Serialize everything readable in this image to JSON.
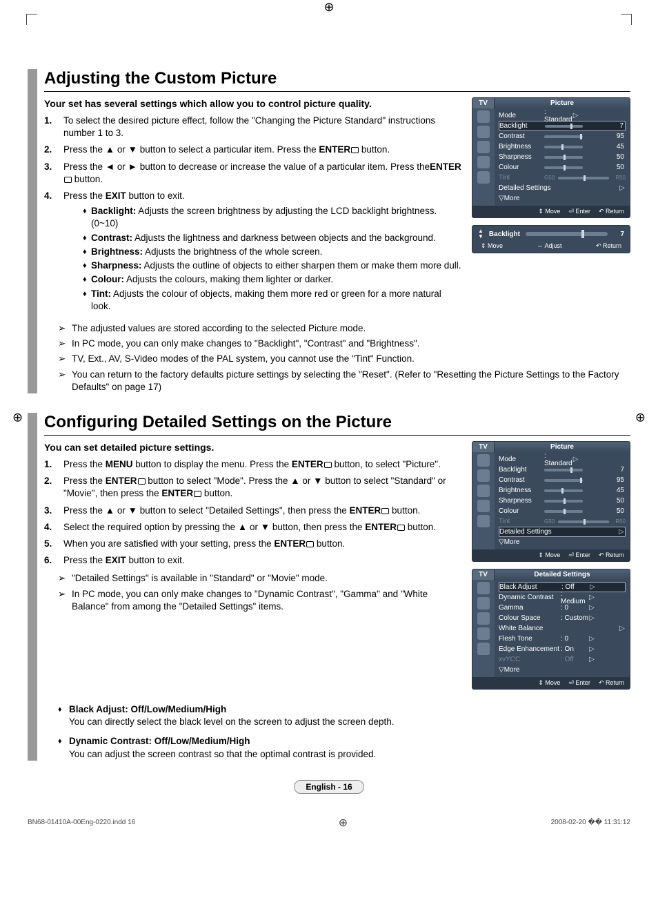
{
  "sections": {
    "s1": {
      "title": "Adjusting the Custom Picture",
      "intro": "Your set has several settings which allow you to control picture quality.",
      "steps": {
        "1a": "To select the desired picture effect, follow the \"Changing the Picture Standard\" instructions number 1 to 3.",
        "2a": "Press the ▲ or ▼ button to select a particular item. Press the ",
        "2b": "ENTER",
        "2c": " button.",
        "3a": "Press the ◄ or ► button to decrease or increase the value of a particular item. Press the",
        "3b": "ENTER",
        "3c": " button.",
        "4a": "Press the ",
        "4b": "EXIT",
        "4c": " button to exit."
      },
      "bullets": {
        "b1l": "Backlight:",
        "b1t": " Adjusts the screen brightness by adjusting the LCD backlight brightness. (0~10)",
        "b2l": "Contrast:",
        "b2t": " Adjusts the lightness and darkness between objects and the background.",
        "b3l": "Brightness:",
        "b3t": " Adjusts the brightness of the whole screen.",
        "b4l": "Sharpness:",
        "b4t": " Adjusts the outline of objects to either sharpen them or make them more dull.",
        "b5l": "Colour:",
        "b5t": " Adjusts the colours, making them lighter or darker.",
        "b6l": "Tint:",
        "b6t": " Adjusts the colour of objects, making them more red or green for a more natural look."
      },
      "notes": {
        "n1": "The adjusted values are stored according to the selected Picture mode.",
        "n2": "In PC mode, you can only make changes to \"Backlight\", \"Contrast\" and  \"Brightness\".",
        "n3": "TV, Ext., AV, S-Video modes of the PAL system, you cannot use the \"Tint\" Function.",
        "n4": "You can return to the factory defaults picture settings by selecting the \"Reset\". (Refer to \"Resetting the Picture Settings to the Factory Defaults\" on page 17)"
      }
    },
    "s2": {
      "title": "Configuring Detailed Settings on the Picture",
      "intro": "You can set detailed picture settings.",
      "steps": {
        "1a": "Press the ",
        "1b": "MENU",
        "1c": " button to display the menu. Press the ",
        "1d": "ENTER",
        "1e": " button, to select \"Picture\".",
        "2a": "Press the ",
        "2b": "ENTER",
        "2c": " button to select \"Mode\". Press the ▲ or ▼ button to select \"Standard\" or \"Movie\", then press the ",
        "2d": "ENTER",
        "2e": " button.",
        "3a": "Press the ▲ or ▼ button to select \"Detailed Settings\", then press the ",
        "3b": "ENTER",
        "3c": " button.",
        "4a": "Select the required option by pressing the ▲ or ▼ button, then press the ",
        "4b": "ENTER",
        "4c": " button.",
        "5a": "When you are satisfied with your setting, press the ",
        "5b": "ENTER",
        "5c": " button.",
        "6a": "Press the ",
        "6b": "EXIT",
        "6c": " button to exit."
      },
      "notes": {
        "n1": "\"Detailed Settings\" is available in \"Standard\" or \"Movie\" mode.",
        "n2": "In PC mode, you can only make changes to \"Dynamic Contrast\", \"Gamma\" and \"White Balance\" from among the \"Detailed Settings\" items."
      },
      "subopts": {
        "o1t": "Black Adjust: Off/Low/Medium/High",
        "o1d": "You can directly select the black level on the screen to adjust the screen depth.",
        "o2t": "Dynamic Contrast: Off/Low/Medium/High",
        "o2d": "You can adjust the screen contrast so that the optimal contrast is provided."
      }
    }
  },
  "osd": {
    "tv": "TV",
    "picture_title": "Picture",
    "detailed_title": "Detailed Settings",
    "rows": {
      "mode_l": "Mode",
      "mode_v": ": Standard",
      "backlight_l": "Backlight",
      "backlight_v": "7",
      "contrast_l": "Contrast",
      "contrast_v": "95",
      "brightness_l": "Brightness",
      "brightness_v": "45",
      "sharpness_l": "Sharpness",
      "sharpness_v": "50",
      "colour_l": "Colour",
      "colour_v": "50",
      "tint_l": "Tint",
      "tint_gl": "G50",
      "tint_gr": "R50",
      "detset_l": "Detailed Settings",
      "more_l": "▽More"
    },
    "footer": {
      "move": "Move",
      "enter": "Enter",
      "return": "Return",
      "adjust": "Adjust"
    },
    "adjust_panel": {
      "label": "Backlight",
      "value": "7"
    },
    "detailed_rows": {
      "black_l": "Black Adjust",
      "black_v": ": Off",
      "dyn_l": "Dynamic Contrast",
      "dyn_v": ": Medium",
      "gamma_l": "Gamma",
      "gamma_v": ": 0",
      "cspace_l": "Colour Space",
      "cspace_v": ": Custom",
      "wb_l": "White Balance",
      "flesh_l": "Flesh Tone",
      "flesh_v": ": 0",
      "edge_l": "Edge Enhancement",
      "edge_v": ": On",
      "xvycc_l": "xvYCC",
      "xvycc_v": ": Off",
      "more_l": "▽More"
    }
  },
  "chart_data": {
    "type": "table",
    "title": "Picture OSD values",
    "rows": [
      {
        "setting": "Mode",
        "value": "Standard"
      },
      {
        "setting": "Backlight",
        "value": 7
      },
      {
        "setting": "Contrast",
        "value": 95
      },
      {
        "setting": "Brightness",
        "value": 45
      },
      {
        "setting": "Sharpness",
        "value": 50
      },
      {
        "setting": "Colour",
        "value": 50
      },
      {
        "setting": "Tint",
        "value": "G50 / R50"
      }
    ]
  },
  "page": {
    "label": "English - 16"
  },
  "printmeta": {
    "left": "BN68-01410A-00Eng-0220.indd   16",
    "right": "2008-02-20   �� 11:31:12"
  }
}
